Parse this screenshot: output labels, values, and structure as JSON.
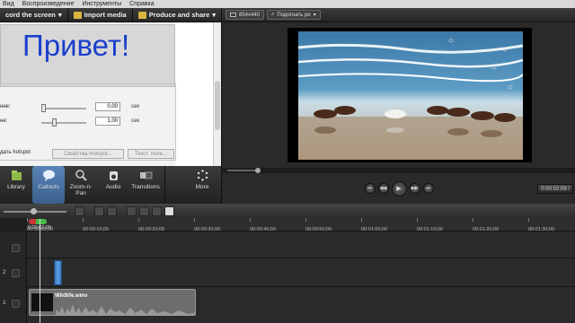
{
  "menu": [
    "Вид",
    "Воспроизведение",
    "Инструменты",
    "Справка"
  ],
  "toolbar": {
    "record_label": "cord the screen",
    "import_label": "Import media",
    "produce_label": "Produce and share"
  },
  "preview_toolbar": {
    "dimensions": "854x440",
    "fit_label": "Подогнать ре"
  },
  "editor": {
    "preview_text": "Привет!",
    "row1_label": "ние:",
    "row1_value": "0,00",
    "row1_unit": "сек",
    "row2_label": "не:",
    "row2_value": "1,00",
    "row2_unit": "сек",
    "hotspot_label": "дать hotspot",
    "hotspot_props_button": "Свойства Hotspot...",
    "text_field_button": "Текст. поле..."
  },
  "tools": [
    {
      "label": "Library",
      "icon": "library-icon"
    },
    {
      "label": "Callouts",
      "icon": "callout-icon"
    },
    {
      "label": "Zoom-n-Pan",
      "icon": "zoom-icon"
    },
    {
      "label": "Audio",
      "icon": "audio-icon"
    },
    {
      "label": "Transitions",
      "icon": "transitions-icon"
    },
    {
      "label": "More",
      "icon": "more-icon"
    }
  ],
  "player": {
    "timecode": "0:00:02;09 /",
    "playhead_fraction": 0.09
  },
  "timeline": {
    "playhead_time": "0:00:02;09",
    "ruler_ticks": [
      "00:00:00;00",
      "00:00:10;00",
      "00:00:20;00",
      "00:00:30;00",
      "00:00:40;00",
      "00:00:50;00",
      "00:01:00;00",
      "00:01:10;00",
      "00:01:20;00",
      "00:01:30;00"
    ],
    "tracks": [
      "1",
      "2",
      ""
    ],
    "media_clip_name": "Wildlife.wmv"
  },
  "colors": {
    "accent": "#3b5f8c",
    "preview_text": "#1a3fcc",
    "callout_clip": "#4a8ad0"
  }
}
